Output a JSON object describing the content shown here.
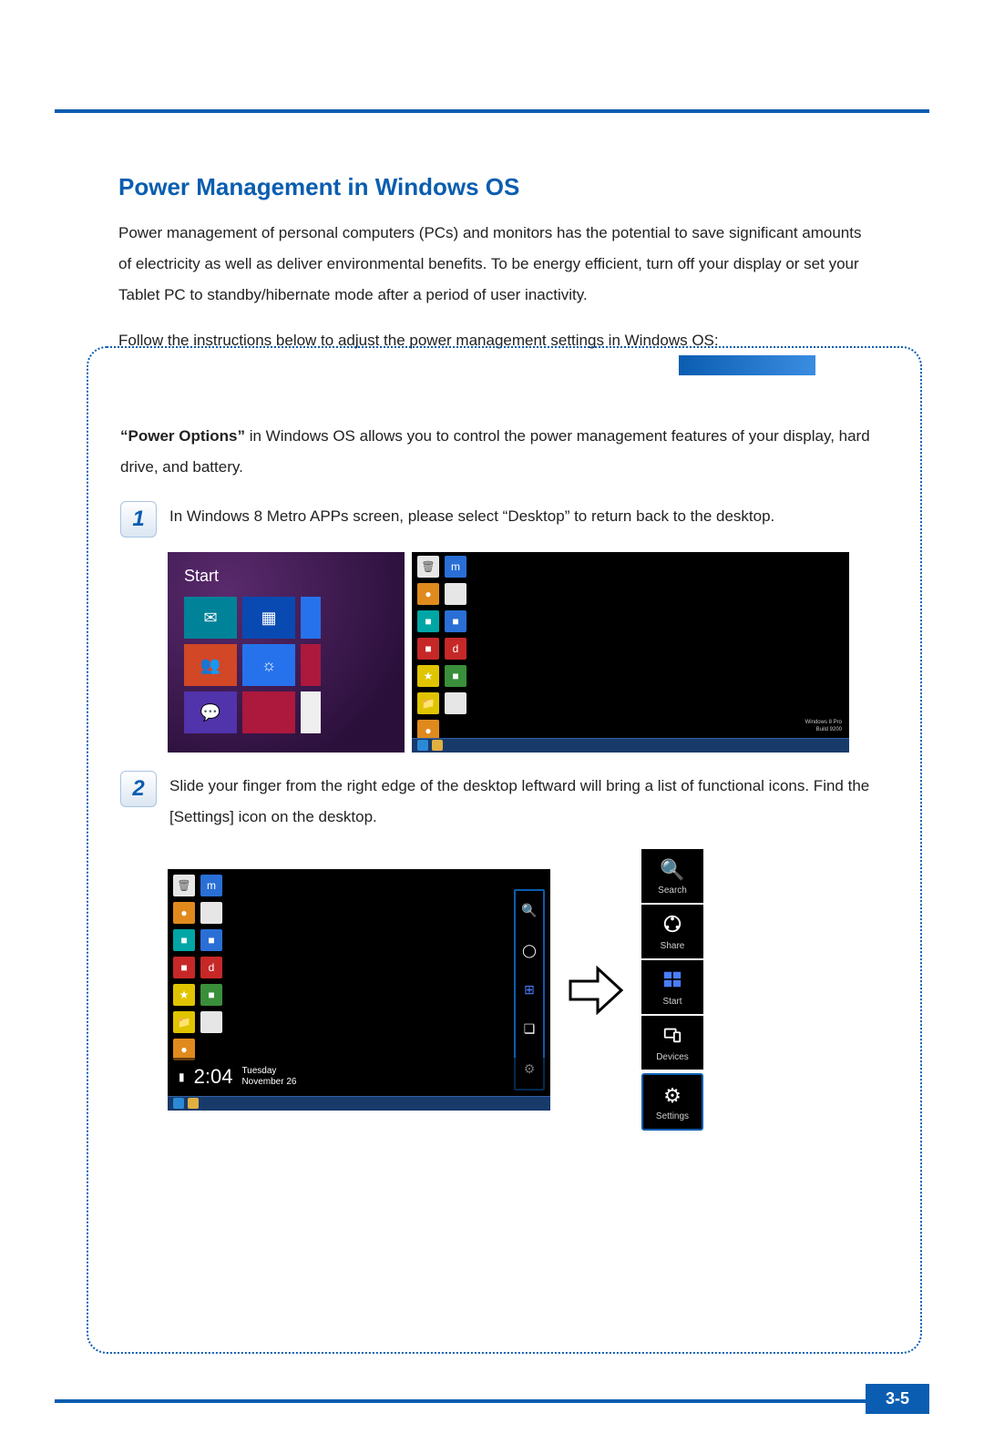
{
  "page": {
    "heading": "Power Management in Windows OS",
    "intro": "Power management of personal computers (PCs) and monitors has the potential to save significant amounts of electricity as well as deliver environmental benefits. To be energy efficient, turn off your display or set your Tablet PC to standby/hibernate mode after a period of user inactivity.",
    "follow": "Follow the instructions below to adjust the power management settings in Windows OS:",
    "number": "3-5"
  },
  "box": {
    "power_options_bold": "“Power Options”",
    "power_options_rest": " in Windows OS allows you to control the power management features of your display, hard drive, and battery.",
    "steps": [
      {
        "num": "1",
        "text": "In Windows 8 Metro APPs screen, please select “Desktop” to return back to the desktop."
      },
      {
        "num": "2",
        "text": "Slide your finger from the right edge of the desktop leftward will bring a list of functional icons. Find the [Settings] icon on the desktop."
      }
    ]
  },
  "start": {
    "title": "Start"
  },
  "desktop_watermark": {
    "line1": "Windows 8 Pro",
    "line2": "Build 9200"
  },
  "clock": {
    "time": "2:04",
    "day": "Tuesday",
    "date": "November 26"
  },
  "charms": [
    {
      "key": "search",
      "label": "Search"
    },
    {
      "key": "share",
      "label": "Share"
    },
    {
      "key": "start",
      "label": "Start"
    },
    {
      "key": "devices",
      "label": "Devices"
    },
    {
      "key": "settings",
      "label": "Settings"
    }
  ]
}
